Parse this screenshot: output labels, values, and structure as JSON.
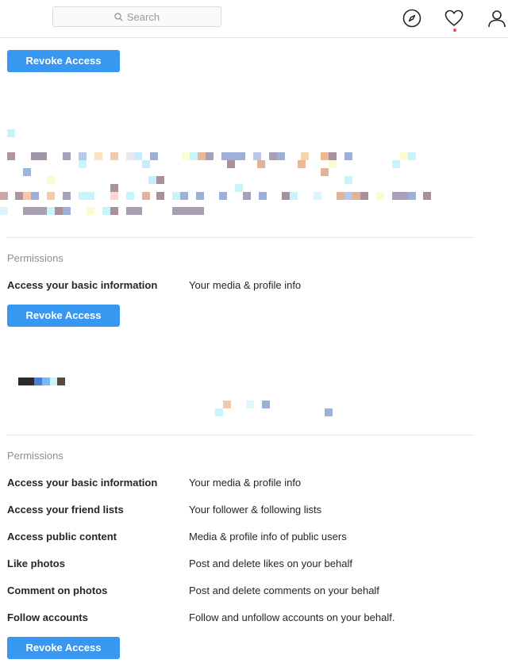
{
  "header": {
    "search_placeholder": "Search",
    "icons": [
      "search-icon",
      "compass-icon",
      "heart-icon",
      "user-icon"
    ],
    "notification_color": "#ed4956"
  },
  "theme": {
    "accent": "#3897f0",
    "muted_text": "#8e8e8e",
    "divider": "#e6e6e6"
  },
  "apps": [
    {
      "revoke_label": "Revoke Access",
      "permissions_title": "",
      "permissions": []
    },
    {
      "revoke_label": "Revoke Access",
      "permissions_title": "Permissions",
      "permissions": [
        {
          "name": "Access your basic information",
          "description": "Your media & profile info"
        }
      ]
    },
    {
      "revoke_label": "Revoke Access",
      "permissions_title": "Permissions",
      "permissions": [
        {
          "name": "Access your basic information",
          "description": "Your media & profile info"
        },
        {
          "name": "Access your friend lists",
          "description": "Your follower & following lists"
        },
        {
          "name": "Access public content",
          "description": "Media & profile info of public users"
        },
        {
          "name": "Like photos",
          "description": "Post and delete likes on your behalf"
        },
        {
          "name": "Comment on photos",
          "description": "Post and delete comments on your behalf"
        },
        {
          "name": "Follow accounts",
          "description": "Follow and unfollow accounts on your behalf."
        }
      ]
    }
  ]
}
